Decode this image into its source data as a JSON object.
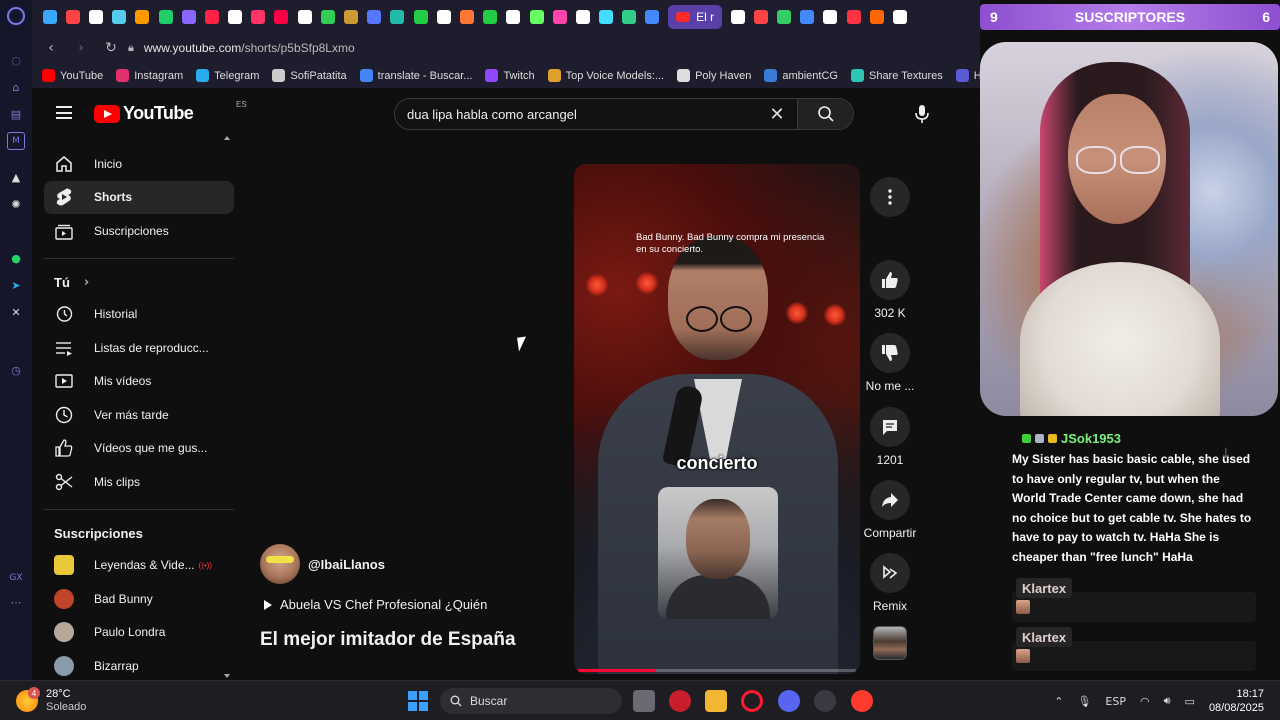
{
  "tabs": {
    "active_label": "El r",
    "favicon_colors": [
      "#3aa7ff",
      "#ff4444",
      "#ffffff",
      "#55ccee",
      "#ff9900",
      "#22cc66",
      "#8866ff",
      "#ff2244",
      "#ffffff",
      "#ff3366",
      "#ff0044",
      "#ffffff",
      "#33cc55",
      "#cc9933",
      "#5577ff",
      "#22bbaa",
      "#22cc44",
      "#ffffff",
      "#ff7733",
      "#22cc44",
      "#ffffff",
      "#66ff66",
      "#ff44aa",
      "#ffffff",
      "#44ddff",
      "#33cc88",
      "#4488ff"
    ],
    "favicon_colors_right": [
      "#ffffff",
      "#ff4444",
      "#33cc66",
      "#4488ff",
      "#ffffff",
      "#ff3344",
      "#ff6600",
      "#ffffff"
    ]
  },
  "address": {
    "host": "www.youtube.com",
    "path": "/shorts/p5bSfp8Lxmo"
  },
  "bookmarks": [
    {
      "label": "YouTube",
      "color": "#ff0000"
    },
    {
      "label": "Instagram",
      "color": "#e1306c"
    },
    {
      "label": "Telegram",
      "color": "#2aabee"
    },
    {
      "label": "SofiPatatita",
      "color": "#cccccc"
    },
    {
      "label": "translate - Buscar...",
      "color": "#4285f4"
    },
    {
      "label": "Twitch",
      "color": "#9146ff"
    },
    {
      "label": "Top Voice Models:...",
      "color": "#e0a030"
    },
    {
      "label": "Poly Haven",
      "color": "#dddddd"
    },
    {
      "label": "ambientCG",
      "color": "#3a7bd5"
    },
    {
      "label": "Share Textures",
      "color": "#2ec4b6"
    },
    {
      "label": "Ha",
      "color": "#5b5bd6"
    }
  ],
  "youtube": {
    "logo_text": "YouTube",
    "country_code": "ES",
    "search_query": "dua lipa habla como arcangel",
    "guide": {
      "main": [
        {
          "label": "Inicio",
          "icon": "home-icon"
        },
        {
          "label": "Shorts",
          "icon": "shorts-icon",
          "active": true
        },
        {
          "label": "Suscripciones",
          "icon": "subscriptions-icon"
        }
      ],
      "you_title": "Tú",
      "you": [
        {
          "label": "Historial",
          "icon": "history-icon"
        },
        {
          "label": "Listas de reproducc...",
          "icon": "playlists-icon"
        },
        {
          "label": "Mis vídeos",
          "icon": "my-videos-icon"
        },
        {
          "label": "Ver más tarde",
          "icon": "watch-later-icon"
        },
        {
          "label": "Vídeos que me gus...",
          "icon": "liked-icon"
        },
        {
          "label": "Mis clips",
          "icon": "clips-icon"
        }
      ],
      "subs_title": "Suscripciones",
      "subs": [
        {
          "label": "Leyendas & Vide...",
          "live": "((•))",
          "color": "#e9c83a"
        },
        {
          "label": "Bad Bunny",
          "color": "#c0442a"
        },
        {
          "label": "Paulo Londra",
          "color": "#b7a89a"
        },
        {
          "label": "Bizarrap",
          "color": "#8a9aa8"
        }
      ]
    },
    "short": {
      "caption_top": "Bad Bunny. Bad Bunny compra mi presencia en su concierto.",
      "caption_word": "concierto",
      "progress_percent": 28,
      "channel": "@IbaiLlanos",
      "playlist": "Abuela VS Chef Profesional ¿Quién",
      "title": "El mejor imitador de España"
    },
    "actions": {
      "likes": "302 K",
      "dislike": "No me ...",
      "comments": "1201",
      "share": "Compartir",
      "remix": "Remix"
    }
  },
  "overlay": {
    "subs_left": "9",
    "subs_label": "SUSCRIPTORES",
    "subs_right": "6",
    "chat": {
      "user": "JSok1953",
      "message": "My Sister has basic basic cable, she used to have only regular tv, but when the World Trade Center came down, she had no choice but to get cable tv. She hates to have to pay to watch tv. HaHa She is cheaper than \"free lunch\" HaHa",
      "next_user_1": "Klartex",
      "next_user_2": "Klartex"
    }
  },
  "taskbar": {
    "weather_badge": "4",
    "temperature": "28°C",
    "condition": "Soleado",
    "search_label": "Buscar",
    "lang": "ESP",
    "time": "18:17",
    "date": "08/08/2025"
  }
}
